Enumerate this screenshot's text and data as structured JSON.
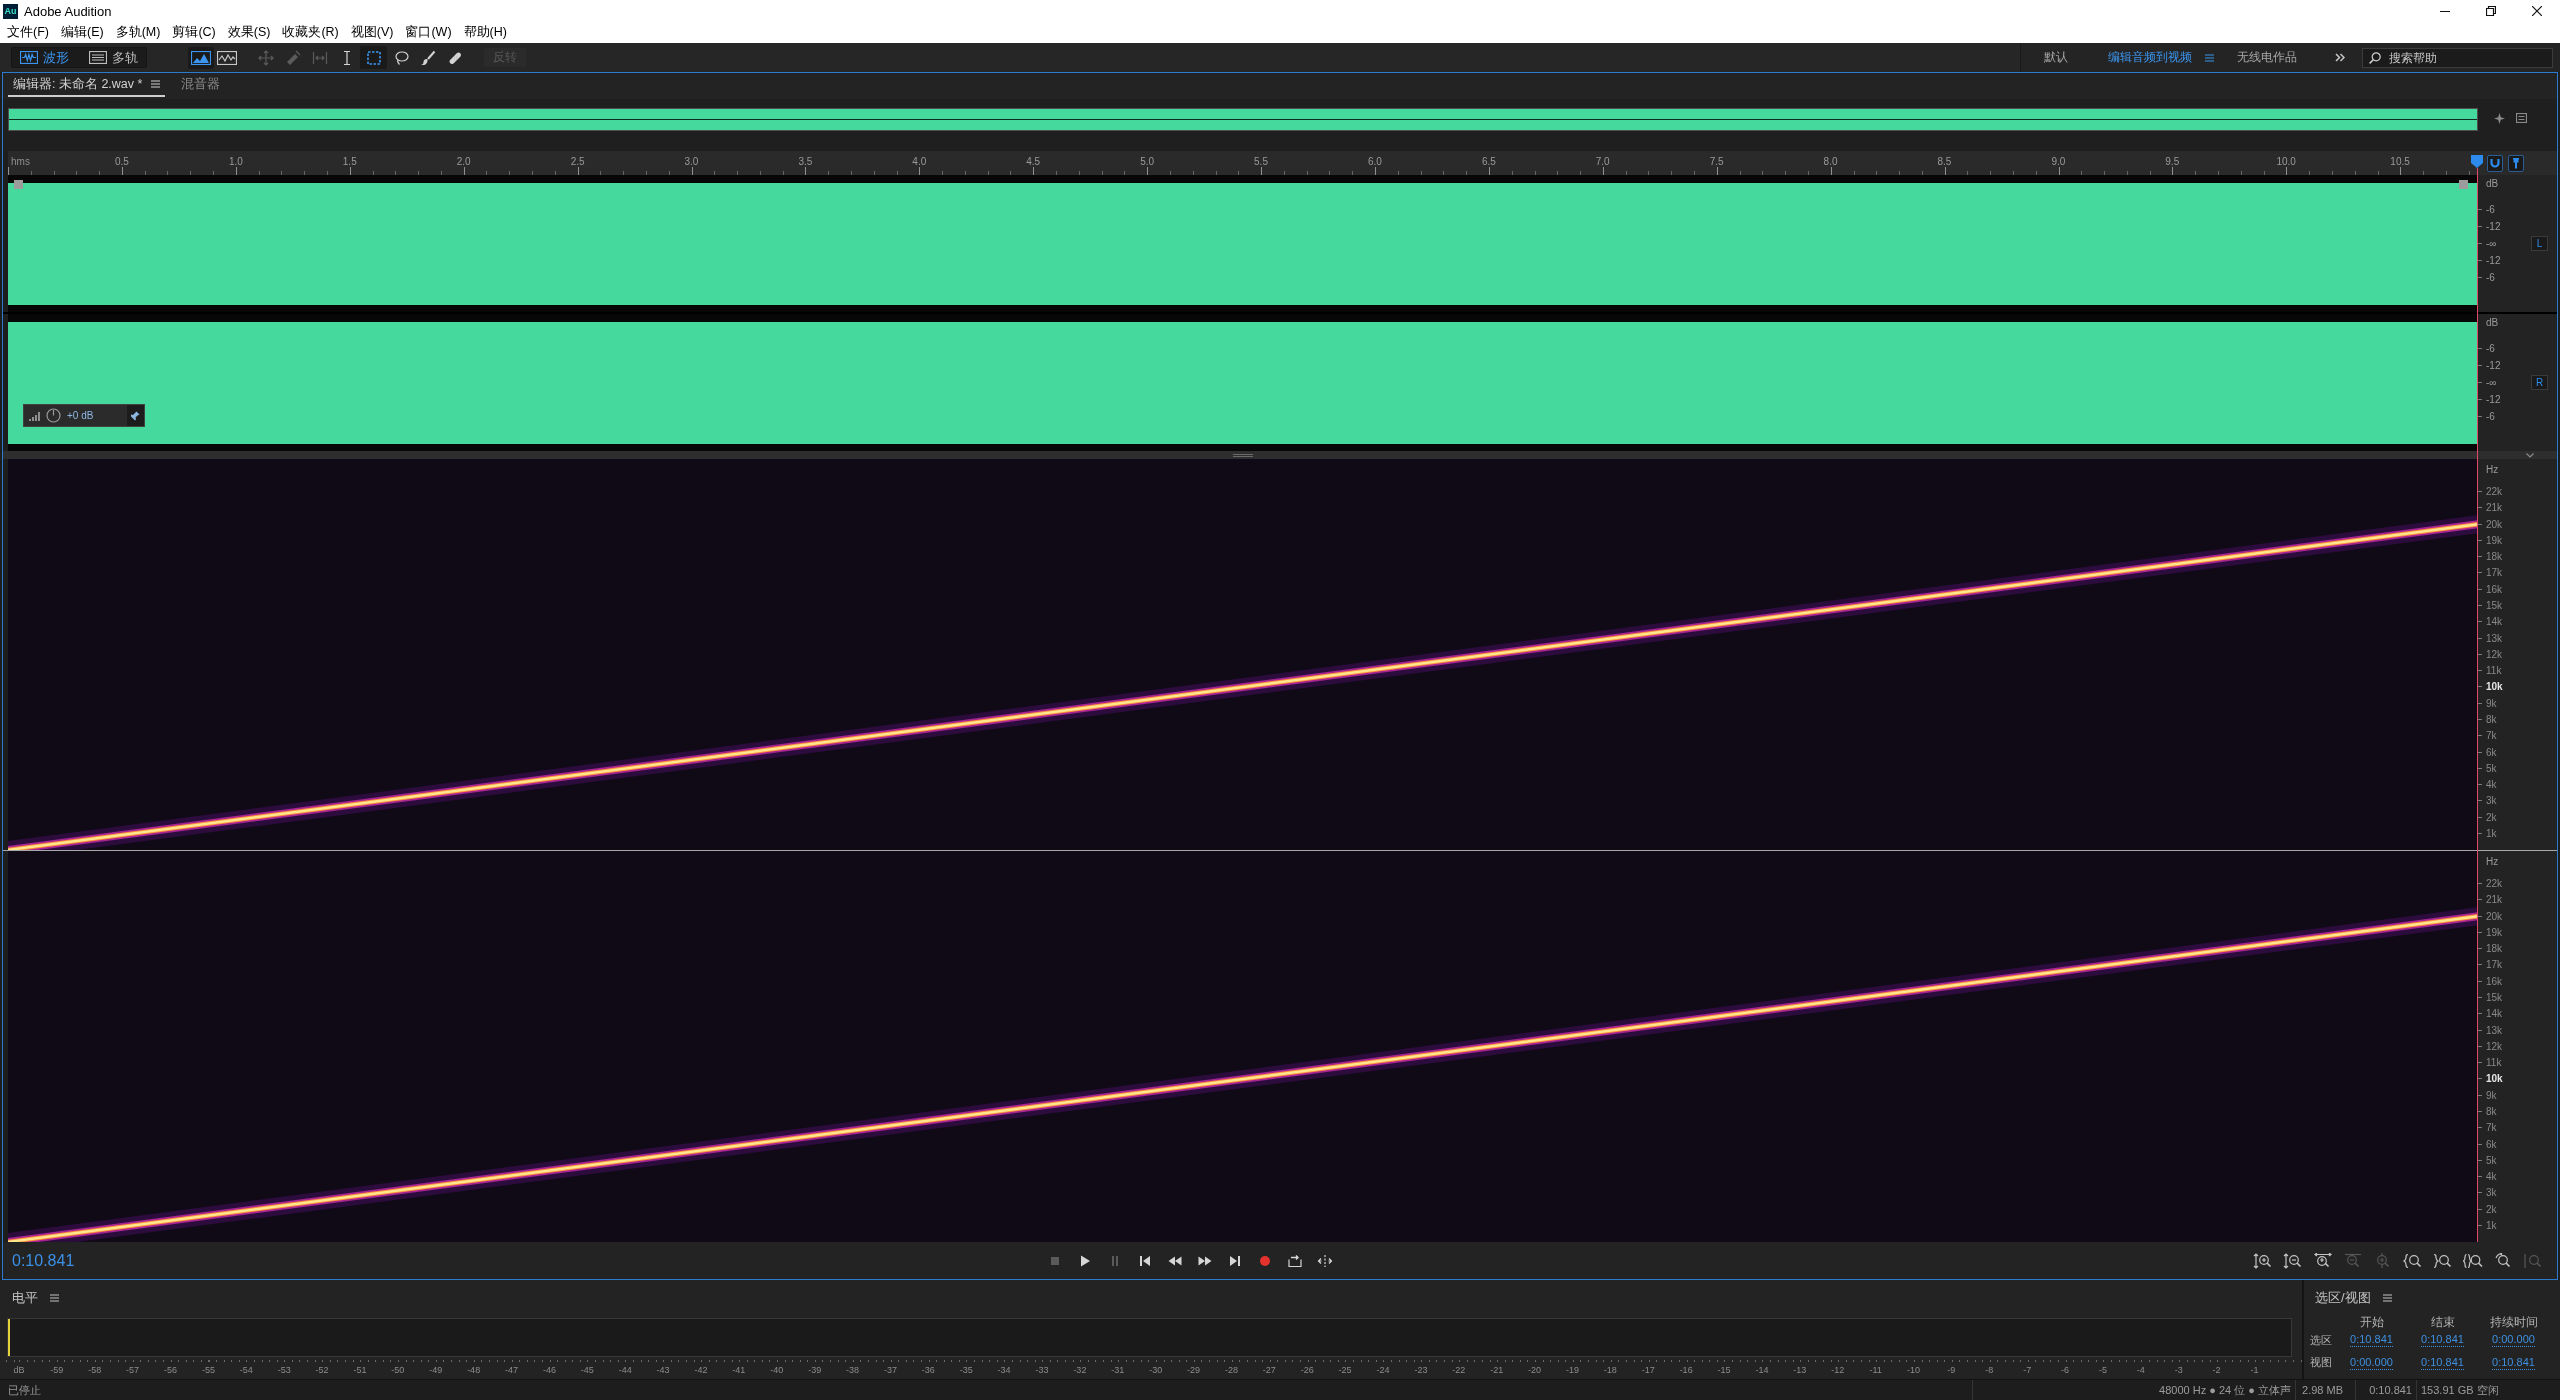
{
  "window": {
    "logo": "Au",
    "title": "Adobe Audition"
  },
  "menu": [
    "文件(F)",
    "编辑(E)",
    "多轨(M)",
    "剪辑(C)",
    "效果(S)",
    "收藏夹(R)",
    "视图(V)",
    "窗口(W)",
    "帮助(H)"
  ],
  "toolbar": {
    "modes": [
      {
        "kind": "waveform",
        "label": "波形",
        "selected": true
      },
      {
        "kind": "multitrack",
        "label": "多轨",
        "selected": false
      }
    ],
    "views": [
      {
        "kind": "frequency",
        "selected": true
      },
      {
        "kind": "pitch",
        "selected": false
      }
    ],
    "tools": [
      {
        "kind": "move",
        "selected": false,
        "disabled": true
      },
      {
        "kind": "razor",
        "selected": false,
        "disabled": true
      },
      {
        "kind": "slip",
        "selected": false,
        "disabled": true
      },
      {
        "kind": "time",
        "selected": false,
        "disabled": false
      },
      {
        "kind": "marquee",
        "selected": true,
        "disabled": false
      },
      {
        "kind": "lasso",
        "selected": false,
        "disabled": false
      },
      {
        "kind": "brush",
        "selected": false,
        "disabled": false
      },
      {
        "kind": "heal",
        "selected": false,
        "disabled": false
      }
    ],
    "invert_button": {
      "label": "反转",
      "disabled": true
    },
    "workspaces": [
      {
        "label": "默认",
        "selected": false
      },
      {
        "label": "编辑音频到视频",
        "selected": true
      },
      {
        "label": "无线电作品",
        "selected": false
      }
    ],
    "search": {
      "placeholder": "搜索帮助"
    }
  },
  "editor": {
    "tabs": [
      {
        "label": "编辑器: 未命名 2.wav *",
        "selected": true
      },
      {
        "label": "混音器",
        "selected": false
      }
    ],
    "ruler": {
      "unit": "hms",
      "labels": [
        "0.5",
        "1.0",
        "1.5",
        "2.0",
        "2.5",
        "3.0",
        "3.5",
        "4.0",
        "4.5",
        "5.0",
        "5.5",
        "6.0",
        "6.5",
        "7.0",
        "7.5",
        "8.0",
        "8.5",
        "9.0",
        "9.5",
        "10.0",
        "10.5"
      ]
    },
    "channels": [
      {
        "badge": "L",
        "scale": [
          "dB",
          "-6",
          "-12",
          "-∞",
          "-12",
          "-6"
        ]
      },
      {
        "badge": "R",
        "scale": [
          "dB",
          "-6",
          "-12",
          "-∞",
          "-12",
          "-6"
        ]
      }
    ],
    "gain": "+0 dB",
    "spectrograms": [
      {
        "unit": "Hz",
        "labels": [
          {
            "text": "22k",
            "bold": false
          },
          {
            "text": "21k",
            "bold": false
          },
          {
            "text": "20k",
            "bold": false
          },
          {
            "text": "19k",
            "bold": false
          },
          {
            "text": "18k",
            "bold": false
          },
          {
            "text": "17k",
            "bold": false
          },
          {
            "text": "16k",
            "bold": false
          },
          {
            "text": "15k",
            "bold": false
          },
          {
            "text": "14k",
            "bold": false
          },
          {
            "text": "13k",
            "bold": false
          },
          {
            "text": "12k",
            "bold": false
          },
          {
            "text": "11k",
            "bold": false
          },
          {
            "text": "10k",
            "bold": true
          },
          {
            "text": "9k",
            "bold": false
          },
          {
            "text": "8k",
            "bold": false
          },
          {
            "text": "7k",
            "bold": false
          },
          {
            "text": "6k",
            "bold": false
          },
          {
            "text": "5k",
            "bold": false
          },
          {
            "text": "4k",
            "bold": false
          },
          {
            "text": "3k",
            "bold": false
          },
          {
            "text": "2k",
            "bold": false
          },
          {
            "text": "1k",
            "bold": false
          }
        ]
      },
      {
        "unit": "Hz",
        "labels": [
          {
            "text": "22k",
            "bold": false
          },
          {
            "text": "21k",
            "bold": false
          },
          {
            "text": "20k",
            "bold": false
          },
          {
            "text": "19k",
            "bold": false
          },
          {
            "text": "18k",
            "bold": false
          },
          {
            "text": "17k",
            "bold": false
          },
          {
            "text": "16k",
            "bold": false
          },
          {
            "text": "15k",
            "bold": false
          },
          {
            "text": "14k",
            "bold": false
          },
          {
            "text": "13k",
            "bold": false
          },
          {
            "text": "12k",
            "bold": false
          },
          {
            "text": "11k",
            "bold": false
          },
          {
            "text": "10k",
            "bold": true
          },
          {
            "text": "9k",
            "bold": false
          },
          {
            "text": "8k",
            "bold": false
          },
          {
            "text": "7k",
            "bold": false
          },
          {
            "text": "6k",
            "bold": false
          },
          {
            "text": "5k",
            "bold": false
          },
          {
            "text": "4k",
            "bold": false
          },
          {
            "text": "3k",
            "bold": false
          },
          {
            "text": "2k",
            "bold": false
          },
          {
            "text": "1k",
            "bold": false
          }
        ]
      }
    ],
    "time": "0:10.841",
    "transport": [
      {
        "kind": "stop",
        "disabled": true
      },
      {
        "kind": "play",
        "disabled": false
      },
      {
        "kind": "pause",
        "disabled": true
      },
      {
        "kind": "to-start",
        "disabled": false
      },
      {
        "kind": "rewind",
        "disabled": false
      },
      {
        "kind": "forward",
        "disabled": false
      },
      {
        "kind": "to-end",
        "disabled": false
      },
      {
        "kind": "record",
        "disabled": false
      },
      {
        "kind": "loop",
        "disabled": false
      },
      {
        "kind": "skip",
        "disabled": false
      }
    ],
    "zoom": [
      {
        "kind": "amp-in",
        "disabled": false
      },
      {
        "kind": "amp-out",
        "disabled": false
      },
      {
        "kind": "full",
        "disabled": false
      },
      {
        "kind": "time-out",
        "disabled": true
      },
      {
        "kind": "center",
        "disabled": true
      },
      {
        "kind": "in-point",
        "disabled": false
      },
      {
        "kind": "out-point",
        "disabled": false
      },
      {
        "kind": "selection",
        "disabled": false
      },
      {
        "kind": "rotate",
        "disabled": false
      },
      {
        "kind": "tracks",
        "disabled": true
      }
    ]
  },
  "levels": {
    "title": "电平",
    "level": 0,
    "scale": [
      "dB",
      "-59",
      "-58",
      "-57",
      "-56",
      "-55",
      "-54",
      "-53",
      "-52",
      "-51",
      "-50",
      "-49",
      "-48",
      "-47",
      "-46",
      "-45",
      "-44",
      "-43",
      "-42",
      "-41",
      "-40",
      "-39",
      "-38",
      "-37",
      "-36",
      "-35",
      "-34",
      "-33",
      "-32",
      "-31",
      "-30",
      "-29",
      "-28",
      "-27",
      "-26",
      "-25",
      "-24",
      "-23",
      "-22",
      "-21",
      "-20",
      "-19",
      "-18",
      "-17",
      "-16",
      "-15",
      "-14",
      "-13",
      "-12",
      "-11",
      "-10",
      "-9",
      "-8",
      "-7",
      "-6",
      "-5",
      "-4",
      "-3",
      "-2",
      "-1"
    ]
  },
  "selection": {
    "title": "选区/视图",
    "columns": [
      "开始",
      "结束",
      "持续时间"
    ],
    "rows": [
      {
        "label": "选区",
        "values": [
          "0:10.841",
          "0:10.841",
          "0:00.000"
        ]
      },
      {
        "label": "视图",
        "values": [
          "0:00.000",
          "0:10.841",
          "0:10.841"
        ]
      }
    ]
  },
  "status_bar": {
    "state": "已停止",
    "format": "48000 Hz ● 24 位 ● 立体声",
    "size": "2.98 MB",
    "duration": "0:10.841",
    "free": "153.91 GB 空闲"
  }
}
